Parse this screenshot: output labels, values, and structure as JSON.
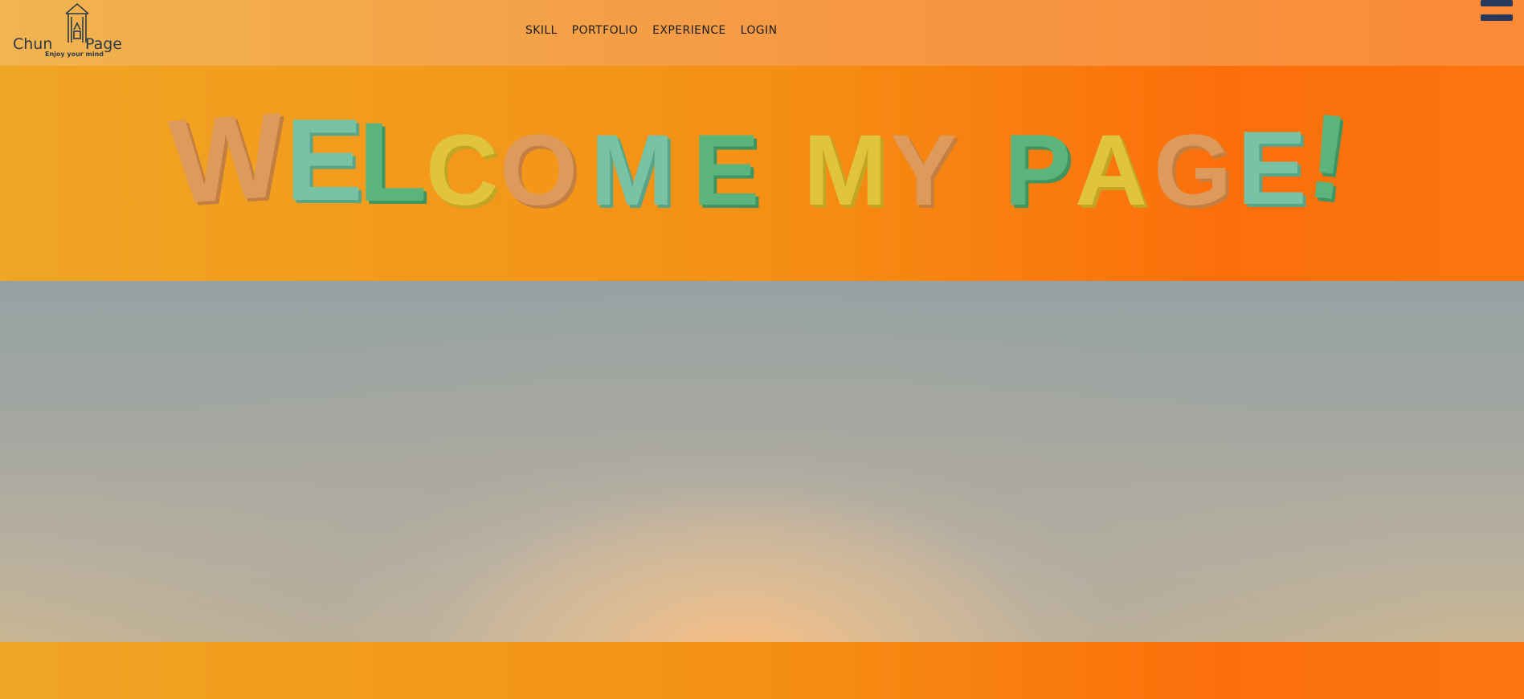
{
  "header": {
    "logo": {
      "word_left": "Chun",
      "word_right": "Page",
      "tagline": "Enjoy your mind"
    },
    "nav": [
      {
        "label": "SKILL"
      },
      {
        "label": "PORTFOLIO"
      },
      {
        "label": "EXPERIENCE"
      },
      {
        "label": "LOGIN"
      }
    ],
    "menu_icon": "hamburger-icon"
  },
  "banner": {
    "letters": [
      "W",
      "E",
      "L",
      "C",
      "O",
      "M",
      "E",
      "M",
      "Y",
      "P",
      "A",
      "G",
      "E",
      "!"
    ]
  },
  "colors": {
    "orange": "#dd9a5a",
    "teal": "#78c3a6",
    "green": "#5cb47d",
    "yellow": "#e0c43c",
    "nav_text": "#1e1e1e",
    "logo_navy": "#2b3b4e"
  }
}
